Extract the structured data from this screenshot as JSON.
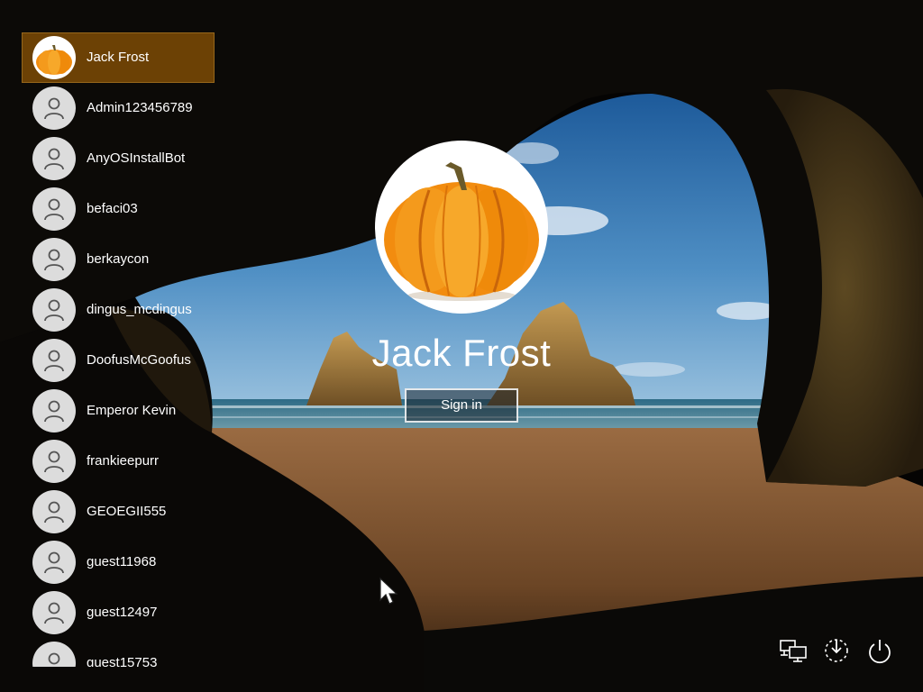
{
  "login": {
    "selected_user": "Jack Frost",
    "sign_in_label": "Sign in"
  },
  "user_list": [
    {
      "name": "Jack Frost",
      "avatar": "pumpkin-avatar",
      "selected": true
    },
    {
      "name": "Admin123456789",
      "avatar": "person-icon"
    },
    {
      "name": "AnyOSInstallBot",
      "avatar": "person-icon"
    },
    {
      "name": "befaci03",
      "avatar": "person-icon"
    },
    {
      "name": "berkaycon",
      "avatar": "person-icon"
    },
    {
      "name": "dingus_mcdingus",
      "avatar": "person-icon"
    },
    {
      "name": "DoofusMcGoofus",
      "avatar": "person-icon"
    },
    {
      "name": "Emperor Kevin",
      "avatar": "person-icon"
    },
    {
      "name": "frankieepurr",
      "avatar": "person-icon"
    },
    {
      "name": "GEOEGII555",
      "avatar": "person-icon"
    },
    {
      "name": "guest11968",
      "avatar": "person-icon"
    },
    {
      "name": "guest12497",
      "avatar": "person-icon"
    },
    {
      "name": "guest15753",
      "avatar": "person-icon"
    }
  ],
  "tray": {
    "network": "network-icon",
    "accessibility": "ease-of-access-icon",
    "power": "power-icon"
  },
  "colors": {
    "selected_bg": "#754705",
    "text": "#ffffff",
    "avatar_bg": "#dcdcdc"
  }
}
